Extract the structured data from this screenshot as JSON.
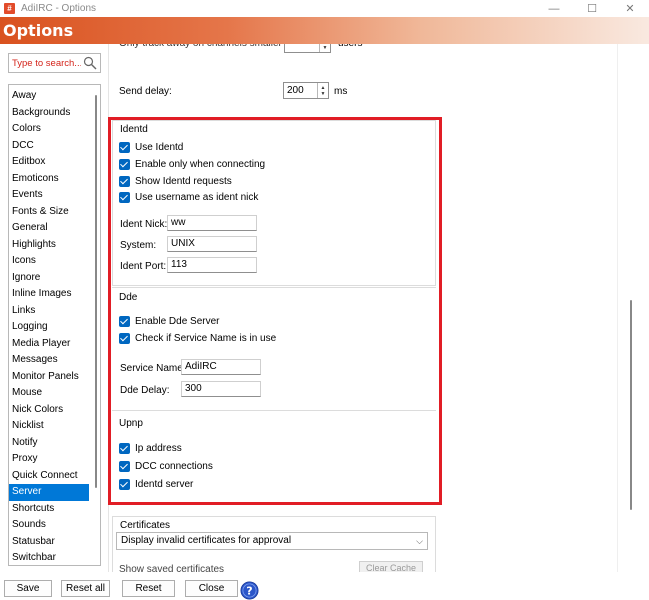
{
  "window": {
    "title": "AdiIRC - Options",
    "icon_glyph": "#",
    "minimize": "—",
    "maximize": "☐",
    "close": "✕"
  },
  "header": {
    "title": "Options"
  },
  "search": {
    "placeholder": "Type to search..."
  },
  "sidebar": {
    "items": [
      "Away",
      "Backgrounds",
      "Colors",
      "DCC",
      "Editbox",
      "Emoticons",
      "Events",
      "Fonts & Size",
      "General",
      "Highlights",
      "Icons",
      "Ignore",
      "Inline Images",
      "Links",
      "Logging",
      "Media Player",
      "Messages",
      "Monitor Panels",
      "Mouse",
      "Nick Colors",
      "Nicklist",
      "Notify",
      "Proxy",
      "Quick Connect",
      "Server",
      "Shortcuts",
      "Sounds",
      "Statusbar",
      "Switchbar"
    ],
    "selected": "Server"
  },
  "top": {
    "partial_label": "Only track away on channels smaller than",
    "partial_suffix": "users",
    "send_delay_label": "Send delay:",
    "send_delay_value": "200",
    "send_delay_unit": "ms"
  },
  "identd": {
    "title": "Identd",
    "checks": [
      "Use Identd",
      "Enable only when connecting",
      "Show Identd requests",
      "Use username as ident nick"
    ],
    "nick_label": "Ident Nick:",
    "nick_value": "ww",
    "system_label": "System:",
    "system_value": "UNIX",
    "port_label": "Ident Port:",
    "port_value": "113"
  },
  "dde": {
    "title": "Dde",
    "checks": [
      "Enable Dde Server",
      "Check if Service Name is in use"
    ],
    "service_label": "Service Name:",
    "service_value": "AdiIRC",
    "delay_label": "Dde Delay:",
    "delay_value": "300"
  },
  "upnp": {
    "title": "Upnp",
    "checks": [
      "Ip address",
      "DCC connections",
      "Identd server"
    ]
  },
  "certificates": {
    "title": "Certificates",
    "select_value": "Display invalid certificates for approval",
    "partial_label": "Show saved certificates",
    "clear_cache": "Clear Cache"
  },
  "buttons": {
    "save": "Save",
    "reset_all": "Reset all",
    "reset": "Reset",
    "close": "Close"
  },
  "colors": {
    "accent": "#0078d7",
    "highlight": "#e11d25",
    "header_start": "#d9521f"
  }
}
